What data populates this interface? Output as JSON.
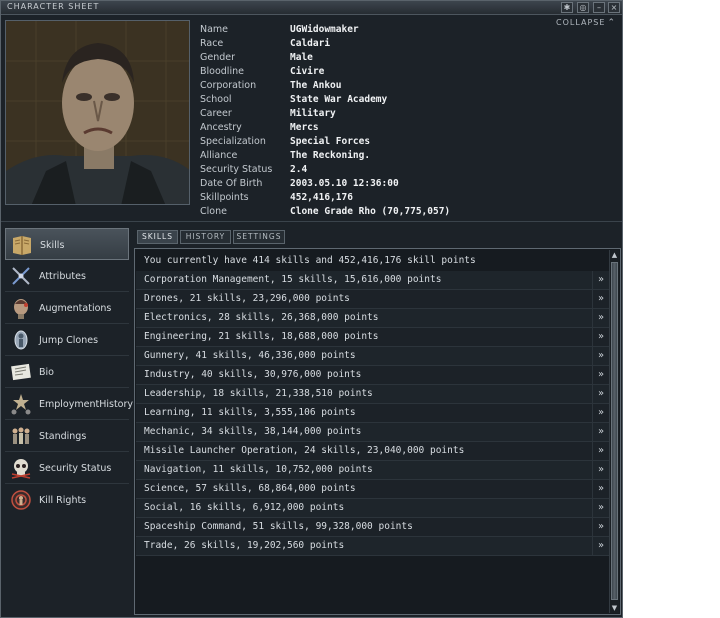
{
  "window": {
    "title": "CHARACTER SHEET",
    "collapse_label": "COLLAPSE"
  },
  "icons": {
    "settings": "gear-icon",
    "options": "circle-icon",
    "minimize": "minimize-icon",
    "close": "close-icon"
  },
  "character": {
    "rows": [
      {
        "label": "Name",
        "value": "UGWidowmaker"
      },
      {
        "label": "Race",
        "value": "Caldari"
      },
      {
        "label": "Gender",
        "value": "Male"
      },
      {
        "label": "Bloodline",
        "value": "Civire"
      },
      {
        "label": "Corporation",
        "value": "The Ankou"
      },
      {
        "label": "School",
        "value": "State War Academy"
      },
      {
        "label": "Career",
        "value": "Military"
      },
      {
        "label": "Ancestry",
        "value": "Mercs"
      },
      {
        "label": "Specialization",
        "value": "Special Forces"
      },
      {
        "label": "Alliance",
        "value": "The Reckoning."
      },
      {
        "label": "Security Status",
        "value": "2.4"
      },
      {
        "label": "Date Of Birth",
        "value": "2003.05.10 12:36:00"
      },
      {
        "label": "Skillpoints",
        "value": "452,416,176"
      },
      {
        "label": "Clone",
        "value": "Clone Grade Rho (70,775,057)"
      }
    ]
  },
  "sidebar": {
    "items": [
      {
        "label": "Skills",
        "icon": "book-icon"
      },
      {
        "label": "Attributes",
        "icon": "dna-icon"
      },
      {
        "label": "Augmentations",
        "icon": "head-implant-icon"
      },
      {
        "label": "Jump Clones",
        "icon": "clone-icon"
      },
      {
        "label": "Bio",
        "icon": "document-icon"
      },
      {
        "label_line1": "Employment",
        "label_line2": "History",
        "icon": "medal-icon"
      },
      {
        "label": "Standings",
        "icon": "people-icon"
      },
      {
        "label": "Security Status",
        "icon": "skull-icon"
      },
      {
        "label": "Kill Rights",
        "icon": "target-icon"
      }
    ]
  },
  "tabs": [
    {
      "label": "SKILLS"
    },
    {
      "label": "HISTORY"
    },
    {
      "label": "SETTINGS"
    }
  ],
  "skills": {
    "summary": "You currently have 414 skills and 452,416,176 skill points",
    "groups": [
      "Corporation Management, 15 skills, 15,616,000 points",
      "Drones, 21 skills, 23,296,000 points",
      "Electronics, 28 skills, 26,368,000 points",
      "Engineering, 21 skills, 18,688,000 points",
      "Gunnery, 41 skills, 46,336,000 points",
      "Industry, 40 skills, 30,976,000 points",
      "Leadership, 18 skills, 21,338,510 points",
      "Learning, 11 skills, 3,555,106 points",
      "Mechanic, 34 skills, 38,144,000 points",
      "Missile Launcher Operation, 24 skills, 23,040,000 points",
      "Navigation, 11 skills, 10,752,000 points",
      "Science, 57 skills, 68,864,000 points",
      "Social, 16 skills, 6,912,000 points",
      "Spaceship Command, 51 skills, 99,328,000 points",
      "Trade, 26 skills, 19,202,560 points"
    ],
    "expand_glyph": "»"
  }
}
